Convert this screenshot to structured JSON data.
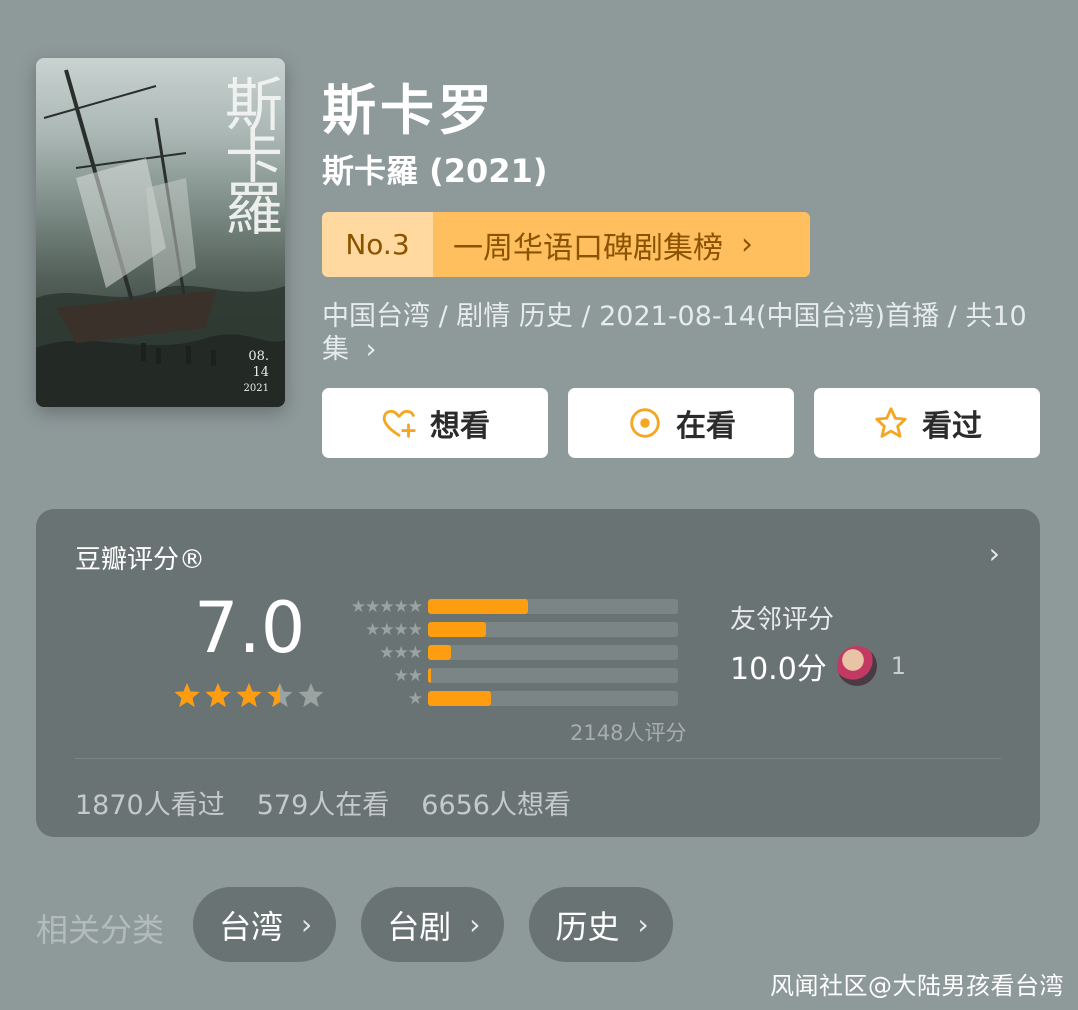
{
  "header": {
    "title": "斯卡罗",
    "subtitle": "斯卡羅 (2021)"
  },
  "poster": {
    "title_art": "斯卡羅",
    "date_line1": "08.",
    "date_line2": "14",
    "year": "2021"
  },
  "rank": {
    "number": "No.3",
    "label": "一周华语口碑剧集榜",
    "chevron": "›"
  },
  "meta": {
    "text": "中国台湾 / 剧情 历史 / 2021-08-14(中国台湾)首播 / 共10集",
    "chevron": "›"
  },
  "actions": [
    {
      "label": "想看",
      "icon": "heart-plus-icon"
    },
    {
      "label": "在看",
      "icon": "target-circle-icon"
    },
    {
      "label": "看过",
      "icon": "star-outline-icon"
    }
  ],
  "rating": {
    "title": "豆瓣评分®",
    "chevron": "›",
    "score": "7.0",
    "stars": 3.5,
    "distribution": [
      {
        "stars": "★★★★★",
        "fraction": 0.4
      },
      {
        "stars": "★★★★",
        "fraction": 0.23
      },
      {
        "stars": "★★★",
        "fraction": 0.09
      },
      {
        "stars": "★★",
        "fraction": 0.01
      },
      {
        "stars": "★",
        "fraction": 0.25
      }
    ],
    "total": "2148人评分",
    "friend_label": "友邻评分",
    "friend_score": "10.0分",
    "friend_count": "1"
  },
  "counts": {
    "watched": "1870人看过",
    "watching": "579人在看",
    "wish": "6656人想看"
  },
  "related": {
    "label": "相关分类",
    "tags": [
      {
        "label": "台湾",
        "chevron": "›"
      },
      {
        "label": "台剧",
        "chevron": "›"
      },
      {
        "label": "历史",
        "chevron": "›"
      }
    ]
  },
  "watermark": "风闻社区@大陆男孩看台湾",
  "colors": {
    "background": "#8e999a",
    "card": "#6a7373",
    "accent_orange": "#ff9d10",
    "rank_badge": "#ffbf5e",
    "star_icon": "#f5a623"
  }
}
